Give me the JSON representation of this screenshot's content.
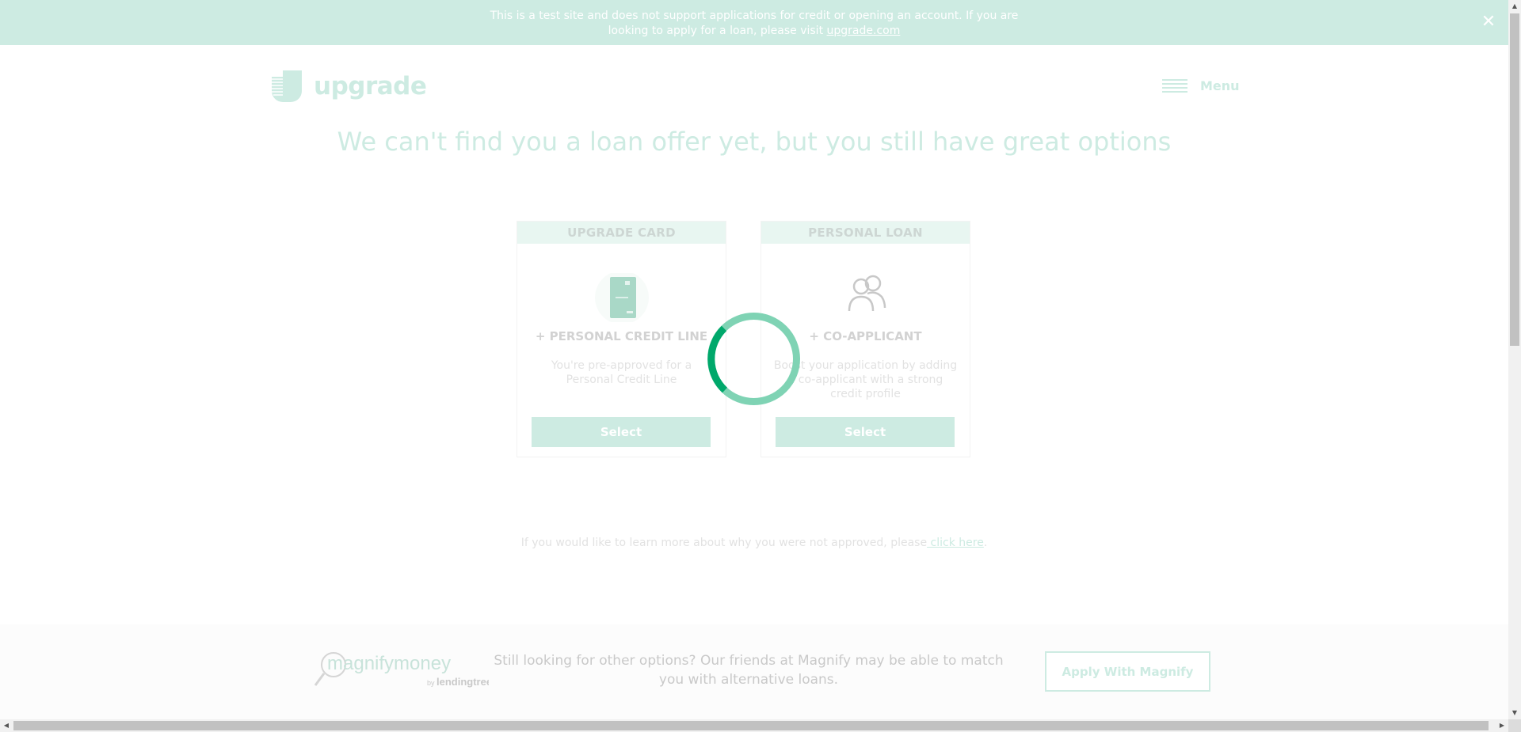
{
  "banner": {
    "text_before": "This is a test site and does not support applications for credit or opening an account. If you are looking to apply for a loan, please visit ",
    "link": "upgrade.com",
    "close_icon": "close-icon"
  },
  "header": {
    "logo_text": "upgrade",
    "menu_label": "Menu",
    "menu_icon": "hamburger-icon"
  },
  "page": {
    "title": "We can't find you a loan offer yet, but you still have great options"
  },
  "cards": [
    {
      "header": "UPGRADE CARD",
      "subtitle": "+ PERSONAL CREDIT LINE",
      "description": "You're pre-approved for a Personal Credit Line",
      "button": "Select",
      "icon": "credit-card-icon"
    },
    {
      "header": "PERSONAL LOAN",
      "subtitle": "+ CO-APPLICANT",
      "description": "Boost your application by adding a co-applicant with a strong credit profile",
      "button": "Select",
      "icon": "people-icon"
    }
  ],
  "not_approved": {
    "text": "If you would like to learn more about why you were not approved, please",
    "link": " click here",
    "period": "."
  },
  "footer": {
    "logo_main": "magnifymoney",
    "logo_by": "by",
    "logo_sub": "lendingtree",
    "text": "Still looking for other options? Our friends at Magnify may be able to match you with alternative loans.",
    "button": "Apply With Magnify"
  },
  "colors": {
    "mint": "#cdebe2",
    "spinner_dark": "#00a86b",
    "spinner_light": "#7fd3b4"
  }
}
